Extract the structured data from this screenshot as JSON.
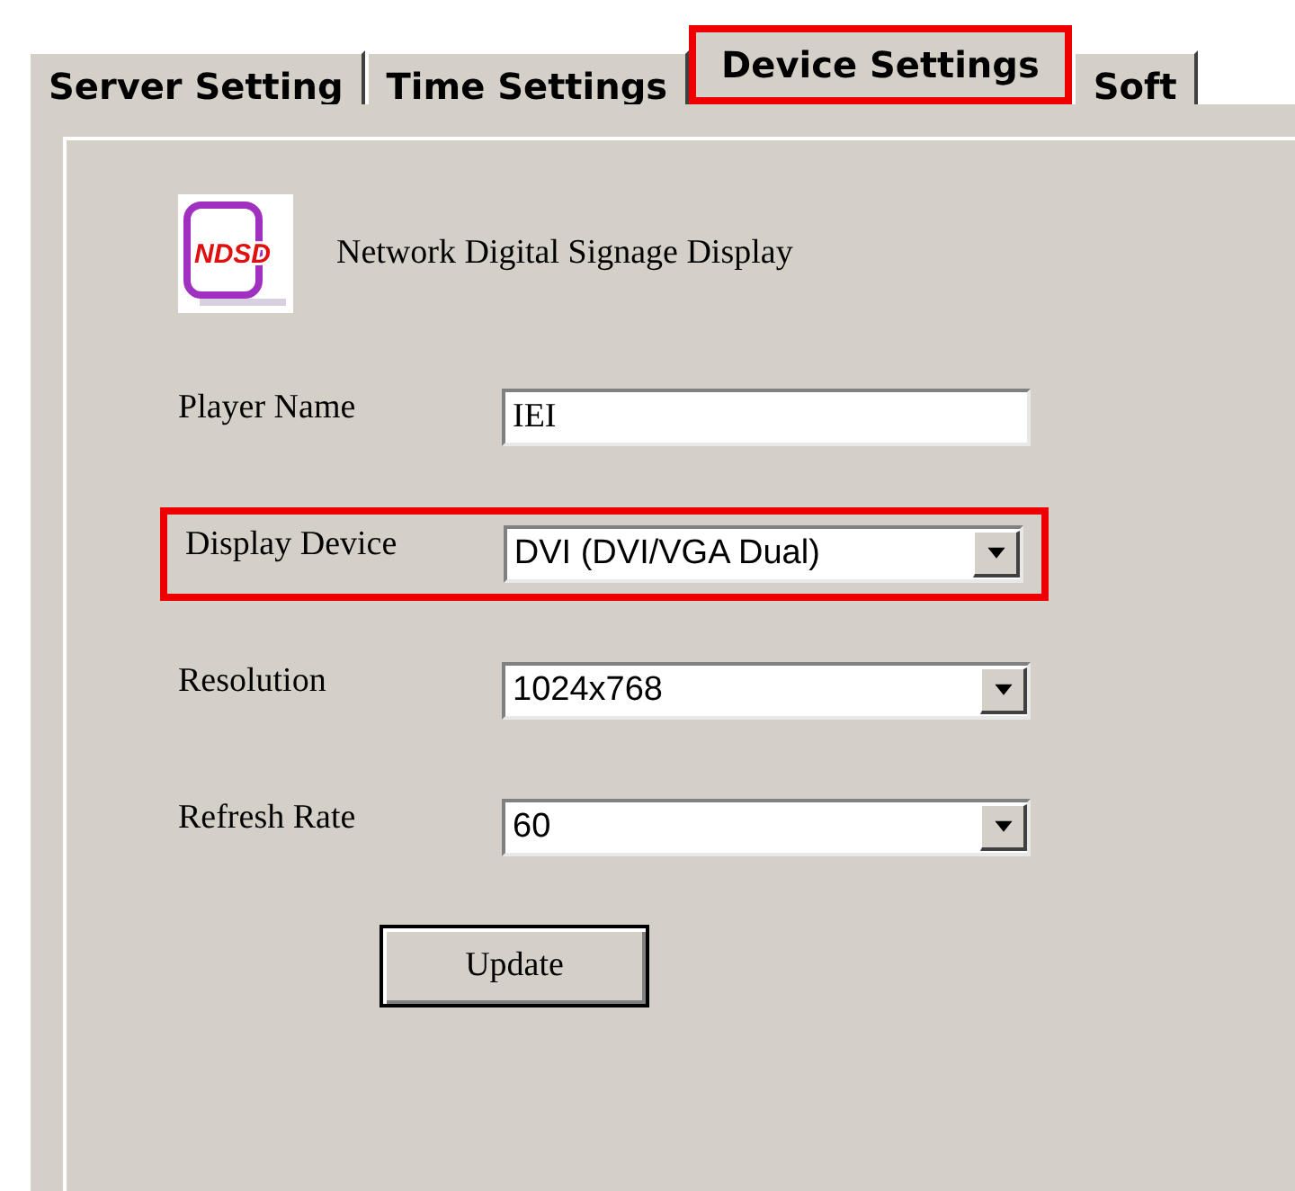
{
  "tabs": [
    {
      "label": "Server Setting",
      "selected": false,
      "highlighted": false
    },
    {
      "label": "Time Settings",
      "selected": false,
      "highlighted": false
    },
    {
      "label": "Device Settings",
      "selected": true,
      "highlighted": true
    },
    {
      "label": "Soft",
      "selected": false,
      "highlighted": false
    }
  ],
  "header": {
    "logo_text": "NDSD",
    "title": "Network Digital Signage Display"
  },
  "fields": [
    {
      "kind": "text",
      "label": "Player Name",
      "value": "IEI",
      "highlighted": false
    },
    {
      "kind": "select",
      "label": "Display Device",
      "value": "DVI (DVI/VGA Dual)",
      "highlighted": true
    },
    {
      "kind": "select",
      "label": "Resolution",
      "value": "1024x768",
      "highlighted": false
    },
    {
      "kind": "select",
      "label": "Refresh Rate",
      "value": "60",
      "highlighted": false
    }
  ],
  "buttons": [
    "Update"
  ]
}
